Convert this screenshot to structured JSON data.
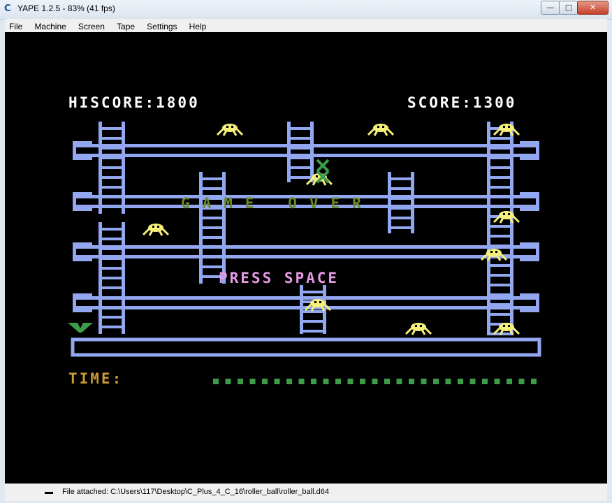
{
  "window": {
    "title": "YAPE 1.2.5 - 83% (41 fps)",
    "controls": {
      "minimize": "—",
      "maximize": "□",
      "close": "✕"
    }
  },
  "menu": [
    "File",
    "Machine",
    "Screen",
    "Tape",
    "Settings",
    "Help"
  ],
  "game": {
    "hiscore_label": "HISCORE:1800",
    "score_label": "SCORE:1300",
    "game_over": "GAME OVER",
    "press_space": "PRESS SPACE",
    "time_label": "TIME:",
    "time_remaining_fraction": 1.0,
    "colors": {
      "girder": "#92a7f0",
      "spider": "#f4f07a",
      "game_over": "#6b8a2a",
      "press_space": "#e79ae6",
      "time_label": "#c99a35",
      "time_bar": "#3d9c48",
      "hiscore": "#ffffff"
    }
  },
  "status": {
    "text": "File attached: C:\\Users\\117\\Desktop\\C_Plus_4_C_16\\roller_ball\\roller_ball.d64"
  }
}
